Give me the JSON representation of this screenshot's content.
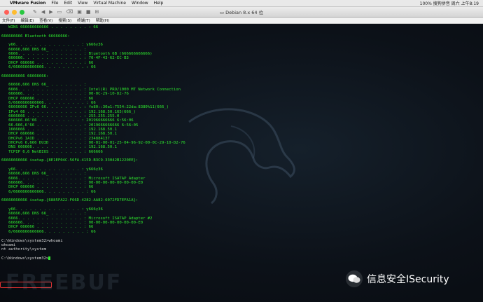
{
  "menubar": {
    "app": "VMware Fusion",
    "items": [
      "File",
      "Edit",
      "View",
      "Virtual Machine",
      "Window",
      "Help"
    ],
    "status": "100%  搜狗拼音  周六 上午8:19"
  },
  "window": {
    "title": "Debian 8.x 64 位"
  },
  "console_menu": [
    "文件(F)",
    "编辑(E)",
    "查看(V)",
    "搜索(S)",
    "终端(T)",
    "帮助(H)"
  ],
  "console_lines": [
    "   WINS 666666666666 . . . . . . . . : 66",
    "",
    "666666666 Bluetooth 66666666:",
    "",
    "   γ66. . . . . . . . . . . . . . : γ666γ36",
    "   66666,666 DNS 66_ . . . . . . . :",
    "   6666. . . . . . . . . . . . . . : Bluetooth 6B (666666666666)",
    "   666666. . . . . . . . . . . . . : 70-4F-43-62-EC-B3",
    "   DHCP 666666 . . . . . . . . . . : 66",
    "   6/6666666666666. . . . . . . . . : 66",
    "",
    "6666666666 66666666:",
    "",
    "   66666,666 DNS 66_ . . . . . . . :",
    "   6666. . . . . . . . . . . . . . : Intel(R) PRO/1000 MT Network Connection",
    "   666666. . . . . . . . . . . . . : 00-0C-29-10-D2-76",
    "   DHCP 666666 . . . . . . . . . . : 66",
    "   6/6666666666666. . . . . . . . . : 66",
    "   66666666 IPv6 66. . . . . . . . : fe80::30a1:7554:22da:8380%11(666_)",
    "   IPv4 66 . . . . . . . . . . . . : 192.168.50.165(666_)",
    "   6666666 . . . . . . . . . . . . : 255.255.255.0",
    "   666666.66'66 . . . . . . . . . : 201966666666 6:56:06",
    "   66.666,6'66 . . . . . . . . . . : 2019666666666 6:56:05",
    "   1666666 . . . . . . . . . . . . : 192.168.50.1",
    "   DHCP 666666 . . . . . . . . . . : 192.168.50.1",
    "   DHCPv6 IAID . . . . . . . . . . : 234884137",
    "   DHCPv6 6,666 DUID . . . . . . . : 00-01-00-01-25-04-96-92-00-0C-29-10-D2-76",
    "   DNS 666666. . . . . . . . . . . : 192.168.50.1",
    "   TCPIP 6,6 NetBIOS . . . . . . . : 666666",
    "",
    "66666666666 isatap.{8E1EF04C-56FA-415D-B3C9-33042B1220EE}:",
    "",
    "   γ66. . . . . . . . . . . . . . : γ666γ36",
    "   66666,666 DNS 66_ . . . . . . . :",
    "   6666. . . . . . . . . . . . . . : Microsoft ISATAP Adapter",
    "   666666. . . . . . . . . . . . . : 00-00-00-00-00-00-00-E0",
    "   DHCP 666666 . . . . . . . . . . : 66",
    "   6/6666666666666. . . . . . . . . : 66",
    "",
    "66666666666 isatap.{6885FA22-F66D-4282-AA82-6072FD7EFA1A}:",
    "",
    "   γ66. . . . . . . . . . . . . . : γ666γ36",
    "   66666,666 DNS 66_ . . . . . . . :",
    "   6666. . . . . . . . . . . . . . : Microsoft ISATAP Adapter #2",
    "   666666. . . . . . . . . . . . . : 00-00-00-00-00-00-00-E0",
    "   DHCP 666666 . . . . . . . . . . : 66",
    "   6/6666666666666. . . . . . . . . : 66",
    "",
    "C:\\Windows\\system32>whoami",
    "whoami",
    "nt authority\\system",
    "",
    "C:\\Windows\\system32>"
  ],
  "watermark_bg": "FREEBUF",
  "watermark": {
    "text": "信息安全ISecurity"
  },
  "colors": {
    "terminal_green": "#2ee82e",
    "highlight": "#e03030"
  }
}
